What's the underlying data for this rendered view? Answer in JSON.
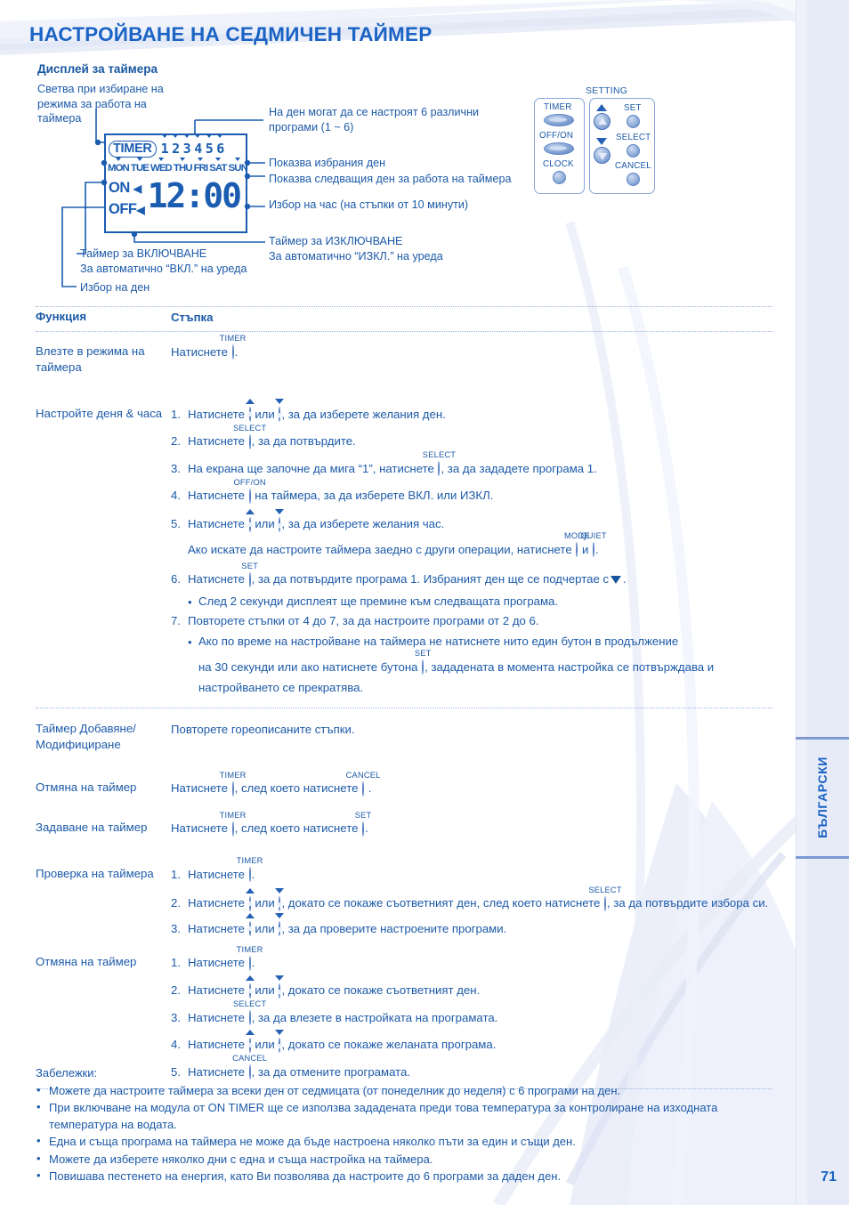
{
  "page": {
    "title": "НАСТРОЙВАНЕ НА СЕДМИЧЕН ТАЙМЕР",
    "number": "71",
    "language_tab": "БЪЛГАРСКИ",
    "accent_color": "#1b63c4",
    "text_color": "#1c5aa8",
    "panel_color": "#e7ebf8"
  },
  "display_section": {
    "heading": "Дисплей за таймера",
    "callouts": {
      "mode_light": "Светва при избиране на режима за работа на таймера",
      "programs": "На ден могат да се настроят 6 различни програми (1 ~ 6)",
      "selected_day": "Показва избрания ден",
      "next_day": "Показва следващия ден за работа на таймера",
      "hour_select": "Избор на час (на стъпки от 10 минути)",
      "off_timer_line1": "Таймер за ИЗКЛЮЧВАНЕ",
      "off_timer_line2": "За автоматично “ИЗКЛ.” на уреда",
      "on_timer_line1": "Таймер за ВКЛЮЧВАНЕ",
      "on_timer_line2": "За автоматично “ВКЛ.” на уреда",
      "day_select": "Избор на ден"
    },
    "lcd": {
      "timer_badge": "TIMER",
      "programs": [
        "1",
        "2",
        "3",
        "4",
        "5",
        "6"
      ],
      "days": [
        "MON",
        "TUE",
        "WED",
        "THU",
        "FRI",
        "SAT",
        "SUN"
      ],
      "on_label": "ON",
      "off_label": "OFF",
      "time": "12:00"
    }
  },
  "remote": {
    "setting_label": "SETTING",
    "buttons": {
      "timer": "TIMER",
      "off_on": "OFF/ON",
      "clock": "CLOCK",
      "set": "SET",
      "select": "SELECT",
      "cancel": "CANCEL"
    }
  },
  "table": {
    "headers": {
      "function": "Функция",
      "step": "Стъпка"
    },
    "rows": [
      {
        "function": "Влезте в режима на таймера",
        "lines": [
          {
            "kind": "plain",
            "pre": "Натиснете ",
            "btn": "TIMER",
            "btn_shape": "oval",
            "post": "."
          }
        ]
      },
      {
        "function": "Настройте деня & часа",
        "lines": [
          {
            "kind": "num",
            "num": "1.",
            "text_a": "Натиснете ",
            "arrows": true,
            "text_b": ", за да изберете желания ден."
          },
          {
            "kind": "num",
            "num": "2.",
            "pre": "Натиснете ",
            "btn": "SELECT",
            "btn_shape": "round",
            "post": ", за да потвърдите."
          },
          {
            "kind": "num",
            "num": "3.",
            "pre": "На екрана ще започне да мига “1”, натиснете ",
            "btn": "SELECT",
            "btn_shape": "round",
            "post": ", за да зададете програма 1."
          },
          {
            "kind": "num",
            "num": "4.",
            "pre": "Натиснете ",
            "btn": "OFF/ON",
            "btn_shape": "oval",
            "post": " на таймера, за да изберете ВКЛ. или ИЗКЛ."
          },
          {
            "kind": "num",
            "num": "5.",
            "text_a": "Натиснете ",
            "arrows": true,
            "text_b": ", за да изберете желания час."
          },
          {
            "kind": "nomark",
            "pre": "Ако искате да настроите таймера заедно с други операции, натиснете ",
            "btn": "MODE",
            "btn_shape": "oval",
            "mid": " и ",
            "btn2": "QUIET",
            "btn2_shape": "oval",
            "post": "."
          },
          {
            "kind": "num",
            "num": "6.",
            "pre": "Натиснете ",
            "btn": "SET",
            "btn_shape": "round",
            "post": ", за да потвърдите програма 1. Избраният ден ще се подчертае с",
            "triangle": true,
            "tail": "."
          },
          {
            "kind": "sub",
            "bullet": "•",
            "text": "След 2 секунди дисплеят ще премине към следващата програма."
          },
          {
            "kind": "num",
            "num": "7.",
            "pre": "Повторете стъпки от 4 до 7, за да настроите програми от 2 до 6.",
            "post": ""
          },
          {
            "kind": "sub",
            "bullet": "•",
            "text": "Ако по време на настройване на таймера не натиснете нито един бутон в продължение"
          },
          {
            "kind": "sub-cont",
            "pre": "на 30 секунди или ако натиснете бутона ",
            "btn": "SET",
            "btn_shape": "round",
            "post": ", зададената в момента настройка се потвърждава и настройването се прекратява."
          }
        ]
      },
      {
        "function": "Таймер Добавяне/ Модифициране",
        "lines": [
          {
            "kind": "plain",
            "pre": "Повторете гореописаните стъпки.",
            "post": ""
          }
        ]
      },
      {
        "function": "Отмяна на таймер",
        "lines": [
          {
            "kind": "plain",
            "pre": "Натиснете ",
            "btn": "TIMER",
            "btn_shape": "oval",
            "mid": ", след което натиснете ",
            "btn2": "CANCEL",
            "btn2_shape": "round",
            "post": "."
          }
        ]
      },
      {
        "function": "Задаване на таймер",
        "lines": [
          {
            "kind": "plain",
            "pre": "Натиснете ",
            "btn": "TIMER",
            "btn_shape": "oval",
            "mid": ", след което натиснете ",
            "btn2": "SET",
            "btn2_shape": "round",
            "post": "."
          }
        ]
      },
      {
        "function": "Проверка на таймера",
        "lines": [
          {
            "kind": "num",
            "num": "1.",
            "pre": "Натиснете ",
            "btn": "TIMER",
            "btn_shape": "oval",
            "post": "."
          },
          {
            "kind": "num",
            "num": "2.",
            "text_a": "Натиснете ",
            "arrows": true,
            "text_b": ", докато се покаже съответният ден, след което натиснете ",
            "btn2": "SELECT",
            "btn2_shape": "round",
            "post": ", за да потвърдите избора си."
          },
          {
            "kind": "num",
            "num": "3.",
            "text_a": "Натиснете ",
            "arrows": true,
            "text_b": ", за да проверите настроените програми."
          }
        ]
      },
      {
        "function": "Отмяна на таймер",
        "lines": [
          {
            "kind": "num",
            "num": "1.",
            "pre": "Натиснете ",
            "btn": "TIMER",
            "btn_shape": "oval",
            "post": "."
          },
          {
            "kind": "num",
            "num": "2.",
            "text_a": "Натиснете ",
            "arrows": true,
            "text_b": ", докато се покаже съответният ден."
          },
          {
            "kind": "num",
            "num": "3.",
            "pre": "Натиснете ",
            "btn": "SELECT",
            "btn_shape": "round",
            "post": ", за да влезете в настройката на програмата."
          },
          {
            "kind": "num",
            "num": "4.",
            "text_a": "Натиснете ",
            "arrows": true,
            "text_b": ", докато се покаже желаната програма."
          },
          {
            "kind": "num",
            "num": "5.",
            "pre": "Натиснете ",
            "btn": "CANCEL",
            "btn_shape": "round",
            "post": ", за да отмените програмата."
          }
        ]
      }
    ]
  },
  "notes": {
    "title": "Забележки:",
    "bullet": "•",
    "items": [
      "Можете да настроите таймера за всеки ден от седмицата (от понеделник до неделя) с 6 програми на ден.",
      "При включване на модула от ON TIMER ще се използва зададената преди това температура за контролиране на изходната температура на водата.",
      "Една и съща програма на таймера не може да бъде настроена няколко пъти за един и същи ден.",
      "Можете да изберете няколко дни с една и съща настройка на таймера.",
      "Повишава пестенето на енергия, като Ви позволява да настроите до 6 програми за даден ден."
    ]
  },
  "inline_label_или": "или"
}
